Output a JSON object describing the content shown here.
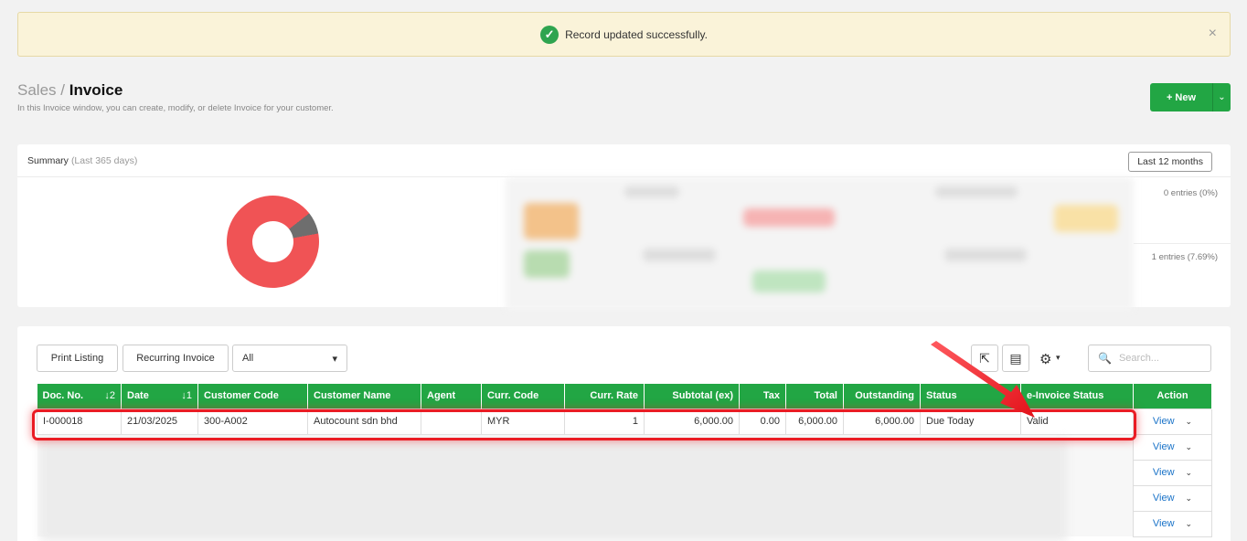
{
  "alert": {
    "message": "Record updated successfully.",
    "close": "×",
    "check": "✓"
  },
  "header": {
    "crumb": "Sales",
    "sep": "/",
    "title": "Invoice",
    "subtitle": "In this Invoice window, you can create, modify, or delete Invoice for your customer."
  },
  "new_button": {
    "label": "+ New",
    "caret": "⌄"
  },
  "summary": {
    "title": "Summary",
    "subtitle": "(Last 365 days)",
    "range_button": "Last 12 months",
    "entries": [
      "0 entries (0%)",
      "1 entries (7.69%)"
    ],
    "donut": {
      "segments": [
        {
          "color": "#6e6e6e",
          "percent": 7.69
        },
        {
          "color": "#f05355",
          "percent": 92.31
        }
      ]
    }
  },
  "listing": {
    "print_button": "Print Listing",
    "recurring_button": "Recurring Invoice",
    "filter_value": "All",
    "filter_caret": "▾",
    "export_icon": "⇱",
    "columns_icon": "▤",
    "gear_icon": "⚙",
    "gear_caret": "▾",
    "search_placeholder": "Search...",
    "search_icon": "🔍",
    "columns": [
      {
        "label": "Doc. No.",
        "sort": "↓2"
      },
      {
        "label": "Date",
        "sort": "↓1"
      },
      {
        "label": "Customer Code"
      },
      {
        "label": "Customer Name"
      },
      {
        "label": "Agent"
      },
      {
        "label": "Curr. Code"
      },
      {
        "label": "Curr. Rate"
      },
      {
        "label": "Subtotal (ex)"
      },
      {
        "label": "Tax"
      },
      {
        "label": "Total"
      },
      {
        "label": "Outstanding"
      },
      {
        "label": "Status"
      },
      {
        "label": "e-Invoice Status"
      },
      {
        "label": "Action"
      }
    ],
    "row": {
      "doc_no": "I-000018",
      "date": "21/03/2025",
      "customer_code": "300-A002",
      "customer_name": "Autocount sdn bhd",
      "agent": "",
      "curr_code": "MYR",
      "curr_rate": "1",
      "subtotal": "6,000.00",
      "tax": "0.00",
      "total": "6,000.00",
      "outstanding": "6,000.00",
      "status": "Due Today",
      "einvoice_status": "Valid"
    },
    "view_label": "View",
    "action_caret": "⌄"
  },
  "colors": {
    "accent": "#22a644",
    "highlight": "#ea1c24",
    "link": "#1a73c8"
  }
}
